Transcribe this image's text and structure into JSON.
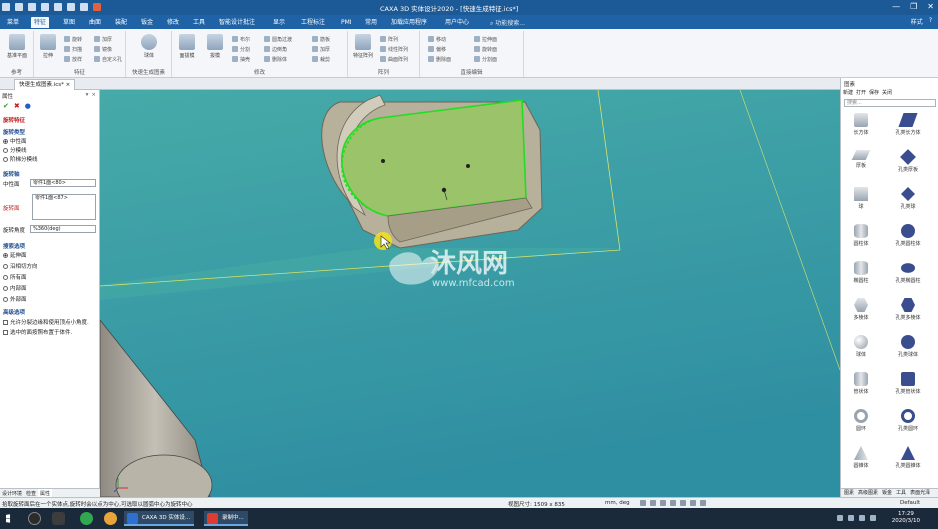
{
  "window": {
    "title": "CAXA 3D 实体设计2020 - [快速生成特征.ics*]",
    "controls": [
      "—",
      "❐",
      "✕"
    ]
  },
  "menu": {
    "tabs": [
      "菜单",
      "特征",
      "草图",
      "曲面",
      "装配",
      "钣金",
      "修改",
      "工具",
      "智能设计批注",
      "显示",
      "工程标注",
      "PMI",
      "常用",
      "加载应用程序",
      "用户中心"
    ],
    "active_tab": "特征",
    "search_placeholder": "功能搜索...",
    "right": [
      "样式",
      "?"
    ]
  },
  "ribbon": {
    "groups": [
      {
        "label": "参考",
        "buttons": [
          "基准平面"
        ]
      },
      {
        "label": "特征",
        "buttons": [
          "拉伸",
          "旋转",
          "扫描",
          "放样",
          "加厚",
          "镜像",
          "自定义孔"
        ]
      },
      {
        "label": "快速生成图素",
        "buttons": [
          "球体"
        ]
      },
      {
        "label": "修改",
        "buttons": [
          "面拔模",
          "拔模",
          "布尔",
          "分割",
          "抽壳",
          "圆角过渡",
          "边倒角",
          "删除体",
          "筋板",
          "加厚",
          "裁剪"
        ]
      },
      {
        "label": "阵列",
        "buttons": [
          "特征阵列",
          "阵列",
          "线性阵列",
          "曲面阵列"
        ]
      },
      {
        "label": "直接编辑",
        "buttons": [
          "移动",
          "偏移",
          "删除面",
          "拉伸面",
          "旋转面",
          "分割面"
        ]
      }
    ]
  },
  "document": {
    "tabs": [
      "快速生成图素.ics*"
    ]
  },
  "properties": {
    "panel_title": "属性",
    "feature_title": "旋转特征",
    "sections": {
      "rotate_type": "旋转类型",
      "rotate_axis": "旋转轴",
      "search_options": "搜索选项",
      "advanced_options": "高级选项"
    },
    "rotate_types": [
      {
        "label": "中性面",
        "checked": true
      },
      {
        "label": "分模线",
        "checked": false
      },
      {
        "label": "阶梯分模线",
        "checked": false
      }
    ],
    "neutral_plane_label": "中性面",
    "neutral_plane_value": "零件1面<80>",
    "rotate_face_label": "旋转面",
    "rotate_face_value": "零件1面<87>",
    "angle_label": "旋转角度",
    "angle_value": "%360(deg)",
    "search_items": [
      {
        "label": "延伸面",
        "checked": true
      },
      {
        "label": "沿相切方向",
        "checked": false
      },
      {
        "label": "所有面",
        "checked": false
      },
      {
        "label": "内部面",
        "checked": false
      },
      {
        "label": "外部面",
        "checked": false
      }
    ],
    "advanced_items": [
      "允许分裂边缘和使用顶点小角度.",
      "选中的面按照布置于体件."
    ],
    "bottom_tabs": [
      "设计环境",
      "检查",
      "属性"
    ]
  },
  "library": {
    "panel_title": "图素",
    "toolbar": [
      "新建",
      "打开",
      "保存",
      "关闭"
    ],
    "search_placeholder": "搜索...",
    "items": [
      [
        "长方体",
        "孔类长方体"
      ],
      [
        "厚板",
        "孔类厚板"
      ],
      [
        "球",
        "孔类球"
      ],
      [
        "圆柱体",
        "孔类圆柱体"
      ],
      [
        "椭圆柱",
        "孔类椭圆柱"
      ],
      [
        "多棱体",
        "孔类多棱体"
      ],
      [
        "球体",
        "孔类球体"
      ],
      [
        "管状体",
        "孔类管状体"
      ],
      [
        "圆环",
        "孔类圆环"
      ],
      [
        "圆锥体",
        "孔类圆锥体"
      ]
    ],
    "bottom_tabs": [
      "图素",
      "高级图素",
      "钣金",
      "工具",
      "表面光泽"
    ]
  },
  "statusbar": {
    "message": "拾取旋转面后在一个实体点,旋转时会以点为中心,可选取以圆弧中心为旋转中心",
    "view_size": "视图尺寸: 1509 x 835",
    "units": "mm, deg",
    "style": "Default"
  },
  "taskbar": {
    "apps": [
      "CAXA 3D 实体设...",
      "录制中..."
    ],
    "time": "17:29",
    "date": "2020/3/10"
  },
  "watermark": {
    "brand": "沐风网",
    "site": "www.mfcad.com"
  },
  "colors": {
    "title_bar": "#1c5a97",
    "menu_bar": "#1f63a6",
    "viewport": "#3fa0a6",
    "selected_face": "#9bc36a",
    "selection_edge": "#22dd22",
    "part_body": "#b9b2a0",
    "cursor_highlight": "#f2e21b"
  }
}
